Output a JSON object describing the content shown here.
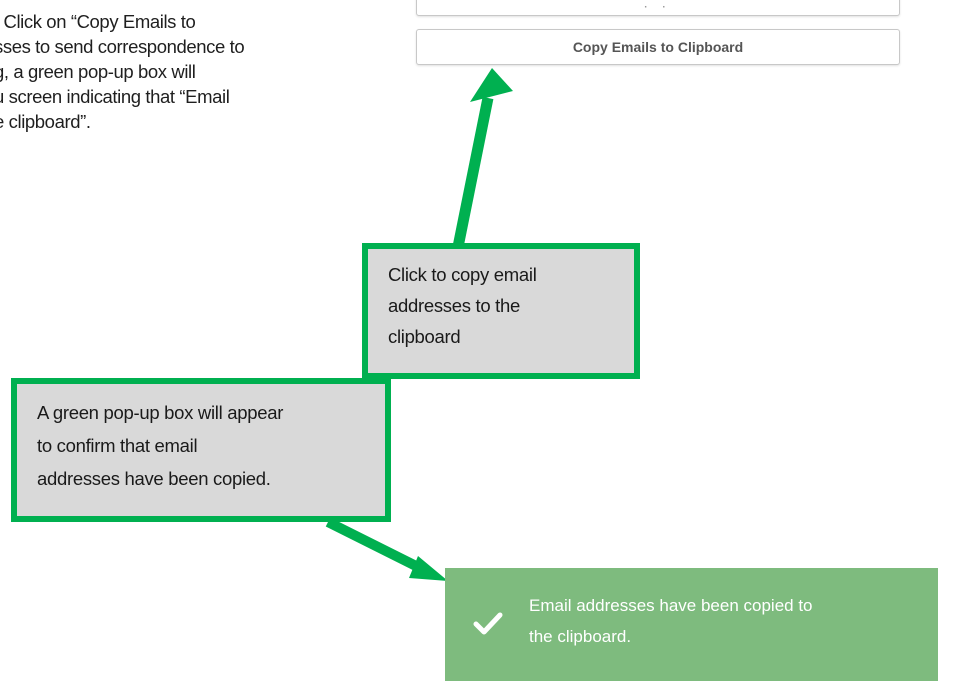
{
  "instruction": {
    "highlight": ":",
    "lines": [
      " Click on “Copy Emails to",
      "sses to send correspondence to",
      "g, a green pop-up box will",
      "u screen indicating that “Email",
      "e clipboard”."
    ]
  },
  "buttons": {
    "partial_label": "· ·",
    "copy_label": "Copy Emails to Clipboard"
  },
  "callouts": {
    "copy": [
      "Click to copy email",
      "addresses to the",
      "clipboard"
    ],
    "popup": [
      "A green pop-up box will appear",
      "to confirm that email",
      "addresses have been copied."
    ]
  },
  "toast": {
    "icon": "checkmark-icon",
    "lines": [
      "Email addresses have been copied to",
      "the clipboard."
    ]
  },
  "colors": {
    "callout_border": "#00b050",
    "callout_fill": "#d9d9d9",
    "toast_bg": "#7ebb7e",
    "highlight": "#cfe8b4"
  }
}
